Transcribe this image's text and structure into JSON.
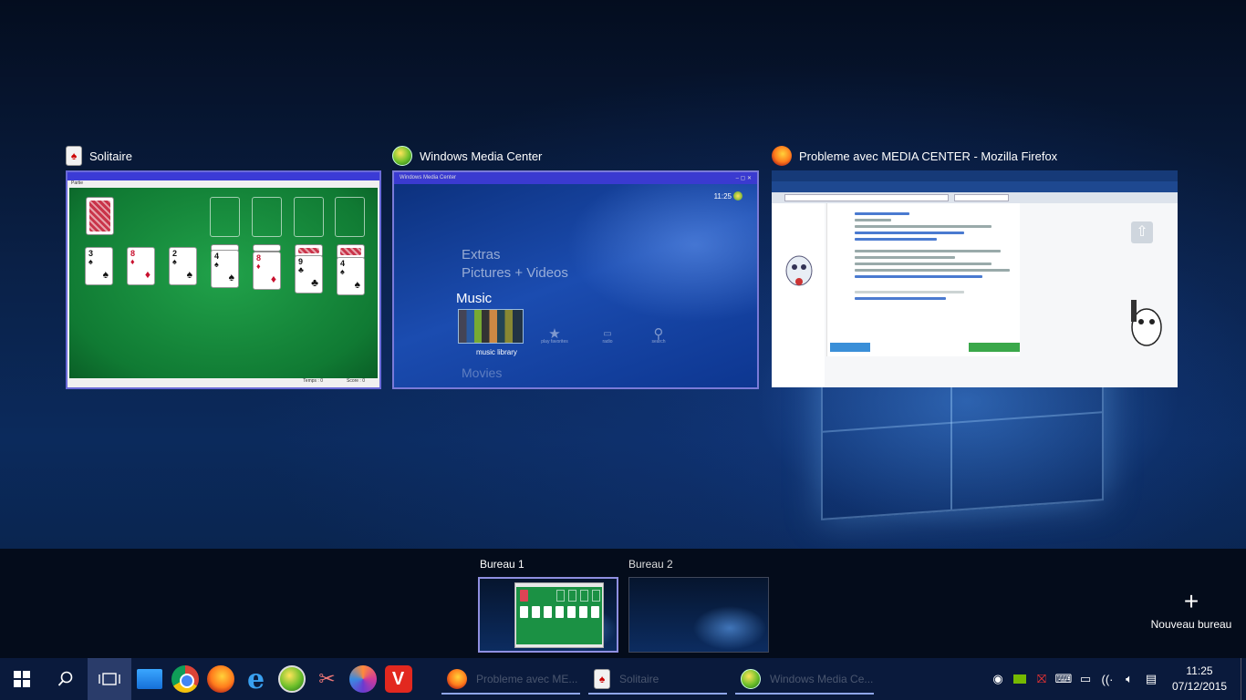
{
  "task_view": {
    "windows": [
      {
        "title": "Solitaire",
        "icon": "solitaire-icon"
      },
      {
        "title": "Windows Media Center",
        "icon": "windows-media-center-icon"
      },
      {
        "title": "Probleme avec MEDIA CENTER - Mozilla Firefox",
        "icon": "firefox-icon"
      }
    ],
    "wmc": {
      "window_title": "Windows Media Center",
      "clock": "11:25",
      "menu_extras": "Extras",
      "menu_pictures": "Pictures + Videos",
      "menu_music": "Music",
      "tile_label": "music library",
      "sub_play_favorites": "play favorites",
      "sub_radio": "radio",
      "sub_search": "search",
      "menu_movies": "Movies"
    },
    "solitaire": {
      "window_title": "Solitaire",
      "menu": "Partie",
      "time": "Temps : 0",
      "score": "Score : 0"
    }
  },
  "desktops": {
    "items": [
      {
        "label": "Bureau 1",
        "active": true
      },
      {
        "label": "Bureau 2",
        "active": false
      }
    ],
    "new_desktop_label": "Nouveau bureau"
  },
  "taskbar": {
    "tasks": [
      {
        "label": "Probleme avec ME...",
        "icon": "firefox-icon"
      },
      {
        "label": "Solitaire",
        "icon": "solitaire-icon"
      },
      {
        "label": "Windows Media Ce...",
        "icon": "windows-media-center-icon"
      }
    ],
    "clock_time": "11:25",
    "clock_date": "07/12/2015"
  },
  "colors": {
    "accent": "#8f8fe0",
    "taskbar": "#0a1a3c"
  }
}
